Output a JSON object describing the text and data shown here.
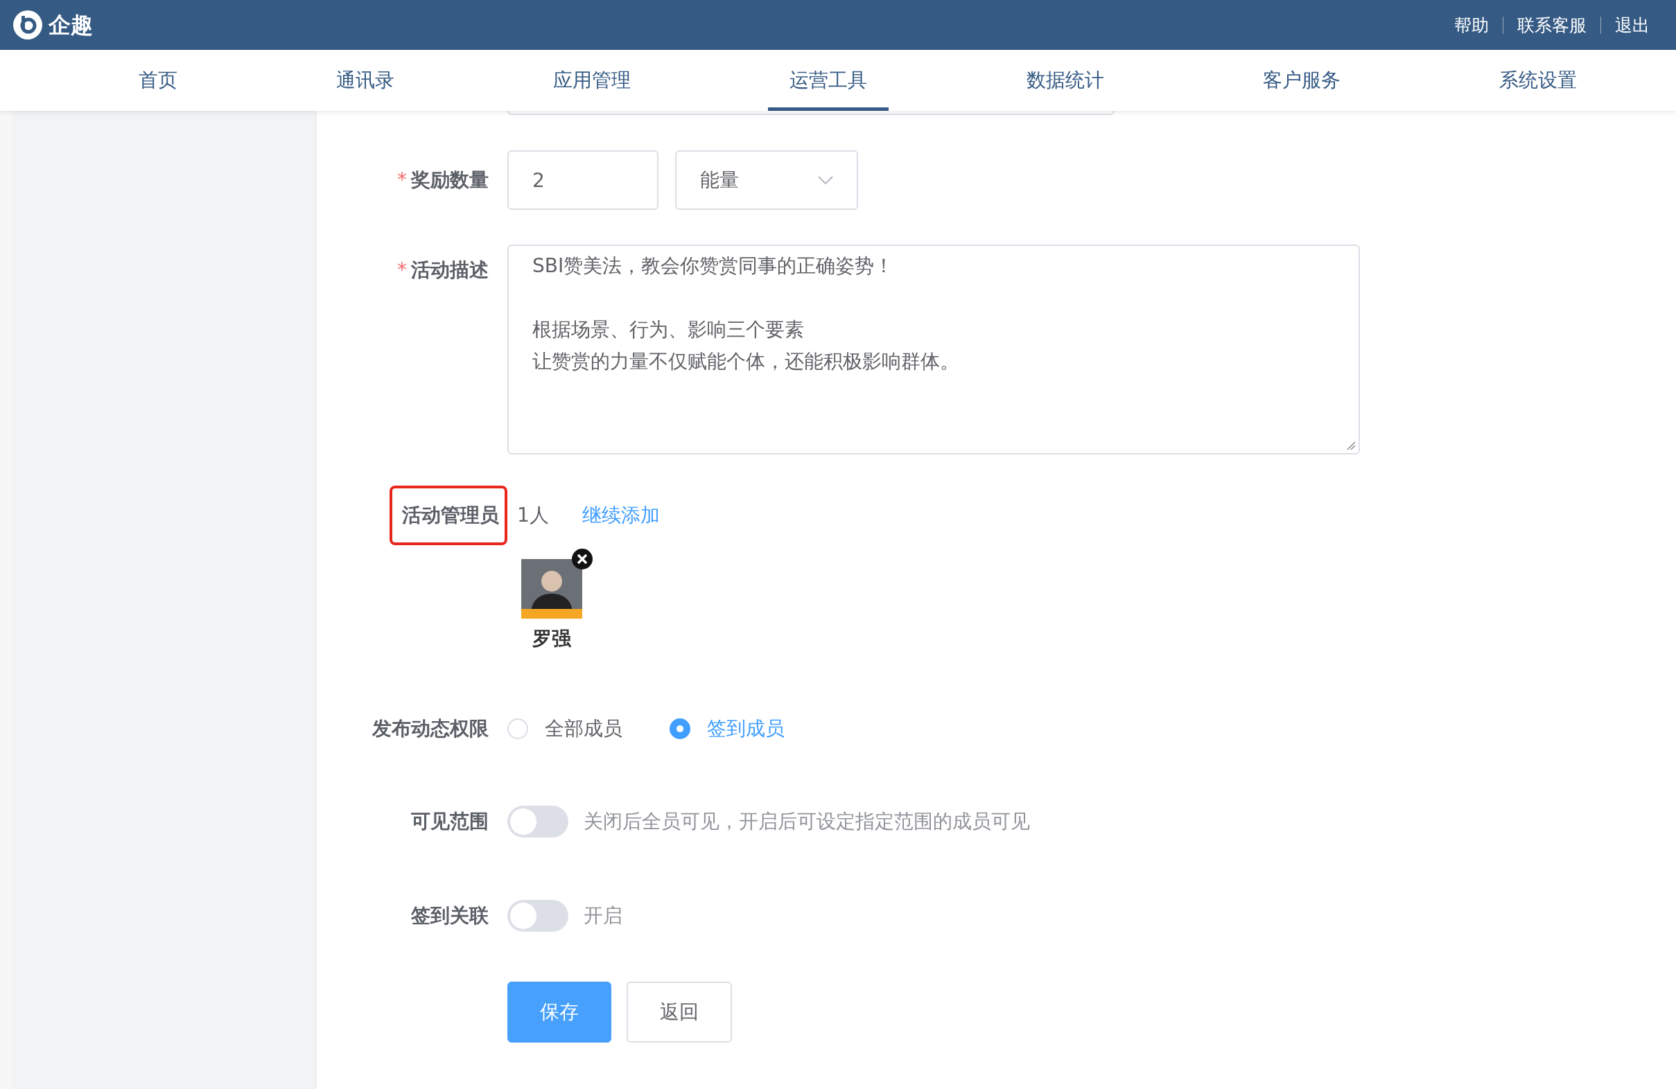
{
  "header": {
    "logo_text": "企趣",
    "links": [
      "帮助",
      "联系客服",
      "退出"
    ]
  },
  "nav": [
    {
      "label": "首页",
      "selected": false
    },
    {
      "label": "通讯录",
      "selected": false
    },
    {
      "label": "应用管理",
      "selected": false
    },
    {
      "label": "运营工具",
      "selected": true
    },
    {
      "label": "数据统计",
      "selected": false
    },
    {
      "label": "客户服务",
      "selected": false
    },
    {
      "label": "系统设置",
      "selected": false
    }
  ],
  "form": {
    "reward": {
      "label": "奖励数量",
      "required_mark": "*",
      "value": "2",
      "unit": "能量"
    },
    "description": {
      "label": "活动描述",
      "required_mark": "*",
      "paragraphs": [
        [
          "SBI赞美法，教会你赞赏同事的正确姿势！"
        ],
        [
          "根据场景、行为、影响三个要素",
          "让赞赏的力量不仅赋能个体，还能积极影响群体。"
        ]
      ]
    },
    "managers": {
      "label": "活动管理员",
      "highlighted": true,
      "count": "1人",
      "add_link": "继续添加",
      "people": [
        {
          "name": "罗强"
        }
      ]
    },
    "publish": {
      "label": "发布动态权限",
      "options": [
        {
          "label": "全部成员",
          "selected": false
        },
        {
          "label": "签到成员",
          "selected": true
        }
      ]
    },
    "toggles": [
      {
        "label": "可见范围",
        "on": false,
        "hint": "关闭后全员可见，开启后可设定指定范围的成员可见"
      },
      {
        "label": "签到关联",
        "on": false,
        "hint": "开启"
      }
    ],
    "buttons": [
      {
        "label": "保存",
        "kind": "primary"
      },
      {
        "label": "返回",
        "kind": "default"
      }
    ]
  }
}
